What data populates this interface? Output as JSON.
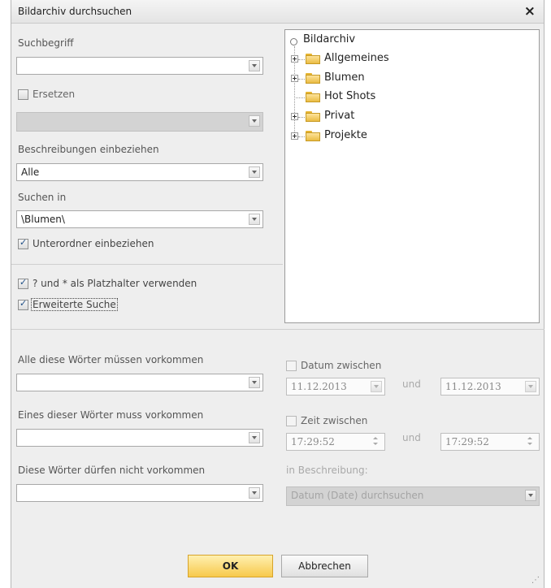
{
  "window": {
    "title": "Bildarchiv durchsuchen",
    "close_label": "×"
  },
  "left": {
    "suchbegriff": {
      "label": "Suchbegriff",
      "value": ""
    },
    "ersetzen": {
      "label": "Ersetzen",
      "value": ""
    },
    "beschreibungen": {
      "label": "Beschreibungen einbeziehen",
      "value": "Alle"
    },
    "suchen_in": {
      "label": "Suchen in",
      "value": "\\Blumen\\"
    },
    "unterordner": {
      "label": "Unterordner einbeziehen"
    },
    "platzhalter": {
      "label": "? und  *  als Platzhalter verwenden"
    },
    "erweitert": {
      "label": "Erweiterte Suche"
    }
  },
  "tree": {
    "root": "Bildarchiv",
    "items": [
      "Allgemeines",
      "Blumen",
      "Hot Shots",
      "Privat",
      "Projekte"
    ]
  },
  "advanced": {
    "alle_woerter": {
      "label": "Alle diese Wörter müssen vorkommen",
      "value": ""
    },
    "eines_wort": {
      "label": "Eines dieser Wörter muss vorkommen",
      "value": ""
    },
    "nicht_woerter": {
      "label": "Diese Wörter dürfen nicht vorkommen",
      "value": ""
    },
    "datum": {
      "label": "Datum zwischen",
      "from": "11.12.2013",
      "to": "11.12.2013",
      "und": "und"
    },
    "zeit": {
      "label": "Zeit zwischen",
      "from": "17:29:52",
      "to": "17:29:52",
      "und": "und"
    },
    "beschreibung": {
      "label": "in Beschreibung:",
      "value": "Datum (Date) durchsuchen"
    }
  },
  "buttons": {
    "ok": "OK",
    "cancel": "Abbrechen"
  },
  "colors": {
    "ok_button": "#f7c94c",
    "folder": "#eabc43",
    "background": "#eeeeee"
  }
}
